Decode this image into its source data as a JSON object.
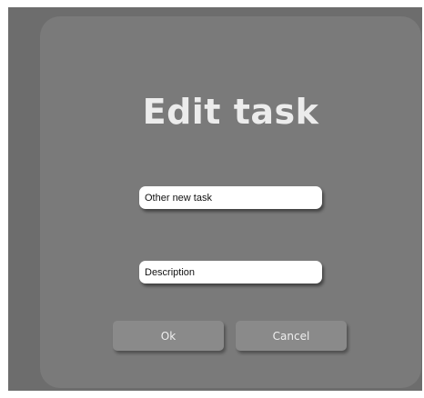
{
  "dialog": {
    "title": "Edit task",
    "task_name_value": "Other new task",
    "description_placeholder": "Description",
    "ok_label": "Ok",
    "cancel_label": "Cancel"
  }
}
